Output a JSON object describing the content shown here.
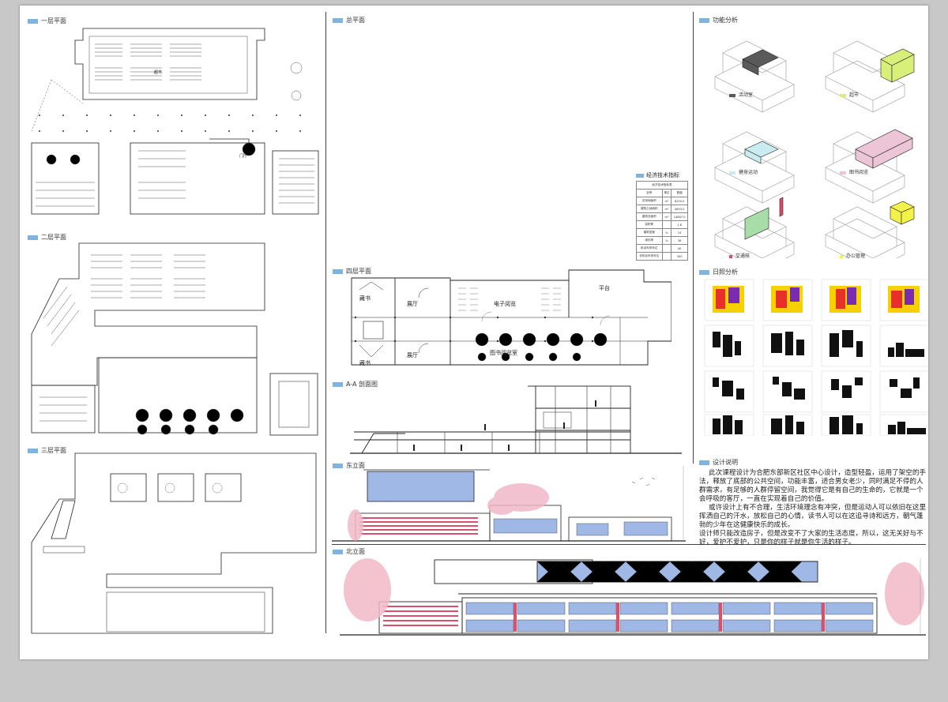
{
  "sections": {
    "floor1": "一层平面",
    "floor2": "二层平面",
    "floor3": "三层平面",
    "site": "总平面",
    "floor4": "四层平面",
    "section_aa": "A-A 剖面图",
    "east_elev": "东立面",
    "north_elev": "北立面",
    "function": "功能分析",
    "sunlight": "日照分析",
    "design_note": "设计说明"
  },
  "function_legend": [
    {
      "label": "活动室",
      "color": "#5a5a5a"
    },
    {
      "label": "超市",
      "color": "#d8f07a"
    },
    {
      "label": "健身运动",
      "color": "#c8ecf0"
    },
    {
      "label": "图书阅览",
      "color": "#ecc6d6"
    },
    {
      "label": "交通核",
      "color": "#e04a60"
    },
    {
      "label": "办公管理",
      "color": "#f2f24a"
    }
  ],
  "econ": {
    "title": "经济技术指标",
    "subtitle": "经济技术指标表",
    "headers": [
      "名称",
      "单位",
      "数值"
    ],
    "rows": [
      [
        "总用地面积",
        "m²",
        "8250.0"
      ],
      [
        "建筑占地面积",
        "m²",
        "4693.0"
      ],
      [
        "建筑总面积",
        "m²",
        "14887.0"
      ],
      [
        "容积率",
        "",
        "1.8"
      ],
      [
        "建筑密度",
        "%",
        "24"
      ],
      [
        "绿化率",
        "%",
        "36"
      ],
      [
        "机动车停车位",
        "",
        "40"
      ],
      [
        "非机动车停车位",
        "",
        "300"
      ]
    ]
  },
  "floor4_rooms": {
    "room_a": "藏书",
    "room_b": "藏书",
    "hall_a": "展厅",
    "hall_b": "展厅",
    "e_reading": "电子阅览",
    "reading": "图书阅览室",
    "terrace": "平台"
  },
  "floor1_rooms": {
    "supermarket": "超市",
    "hall": "门厅"
  },
  "design_note": [
    "此次课程设计为合肥东部新区社区中心设计，造型轻盈，运用了架空的手法，释放了底部的公共空间，功能丰富，适合男女老少，同时满足不停的人群需求，有足够的人群停留空间，我觉得它是有自己的生命的，它就是一个会呼吸的客厅，一直在实现着自己的价值。",
    "或许设计上有不合理，生活环境理念有冲突，但是运动人可以依旧在这里挥洒自己的汗水，放松自己的心情，读书人可以在这追寻诗和远方，朝气蓬勃的少年在这健康快乐的成长。",
    "设计师只能改造房子，但是改变不了大家的生活态度，所以，这无关好与不好，爱护不爱护，只是你的样子就是你生活的样子。"
  ],
  "colors": {
    "accent_tag": "#7fb4e0",
    "glass_blue": "#9fb8e6",
    "stripe_red": "#d9506a",
    "tree_pink": "#f2b8c8"
  }
}
